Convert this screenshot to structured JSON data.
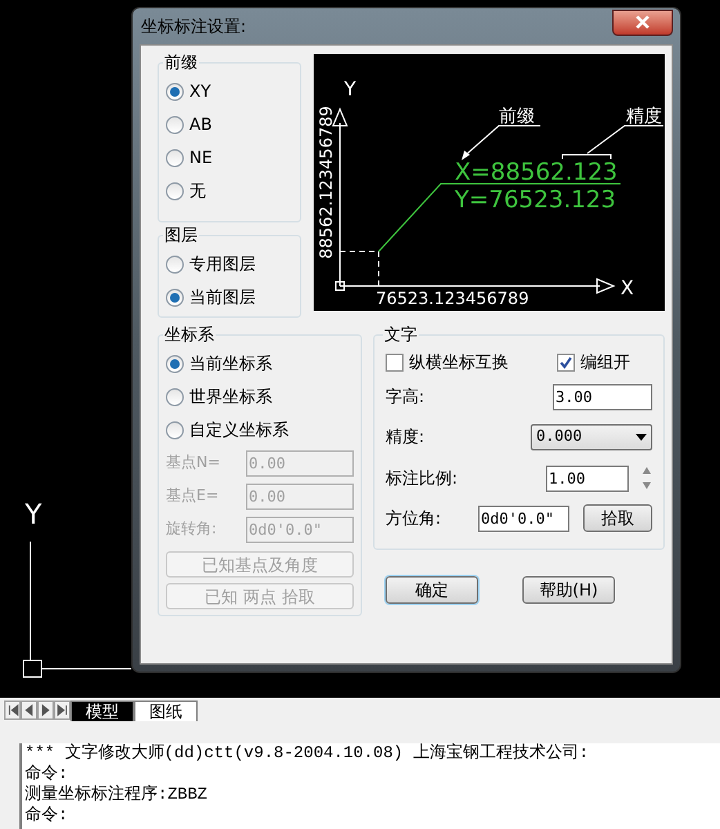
{
  "window": {
    "title": "坐标标注设置:"
  },
  "prefix": {
    "title": "前缀",
    "options": [
      {
        "label": "XY",
        "selected": true
      },
      {
        "label": "AB",
        "selected": false
      },
      {
        "label": "NE",
        "selected": false
      },
      {
        "label": "无",
        "selected": false
      }
    ]
  },
  "layer": {
    "title": "图层",
    "options": [
      {
        "label": "专用图层",
        "selected": false
      },
      {
        "label": "当前图层",
        "selected": true
      }
    ]
  },
  "preview": {
    "y_axis": "Y",
    "x_axis": "X",
    "vertical_value": "88562.123456789",
    "horizontal_value": "76523.123456789",
    "prefix_label": "前缀",
    "precision_label": "精度",
    "x_text": "X=88562.123",
    "y_text": "Y=76523.123"
  },
  "coordinate_system": {
    "title": "坐标系",
    "options": [
      {
        "label": "当前坐标系",
        "selected": true
      },
      {
        "label": "世界坐标系",
        "selected": false
      },
      {
        "label": "自定义坐标系",
        "selected": false
      }
    ],
    "fields": [
      {
        "label": "基点N=",
        "value": "0.00",
        "disabled": true
      },
      {
        "label": "基点E=",
        "value": "0.00",
        "disabled": true
      },
      {
        "label": "旋转角:",
        "value": "0d0'0.0\"",
        "disabled": true
      }
    ],
    "buttons": [
      {
        "label": "已知基点及角度",
        "disabled": true
      },
      {
        "label": "已知 两点 拾取",
        "disabled": true
      }
    ]
  },
  "text": {
    "title": "文字",
    "swap": {
      "label": "纵横坐标互换",
      "checked": false
    },
    "group": {
      "label": "编组开",
      "checked": true
    },
    "height": {
      "label": "字高:",
      "value": "3.00"
    },
    "precision": {
      "label": "精度:",
      "value": "0.000"
    },
    "scale": {
      "label": "标注比例:",
      "value": "1.00"
    },
    "azimuth": {
      "label": "方位角:",
      "value": "0d0'0.0\""
    },
    "pick_button": "拾取"
  },
  "buttons": [
    {
      "label": "确定",
      "kind": "default"
    },
    {
      "label": "帮助(H)",
      "kind": "normal"
    }
  ],
  "canvas": {
    "ucs_label": "Y"
  },
  "tabs": [
    {
      "label": "模型",
      "selected": true
    },
    {
      "label": "图纸",
      "selected": false
    }
  ],
  "command_lines": [
    "*** 文字修改大师(dd)ctt(v9.8-2004.10.08)   上海宝钢工程技术公司:",
    "命令:",
    "测量坐标标注程序:ZBBZ",
    "命令:"
  ]
}
